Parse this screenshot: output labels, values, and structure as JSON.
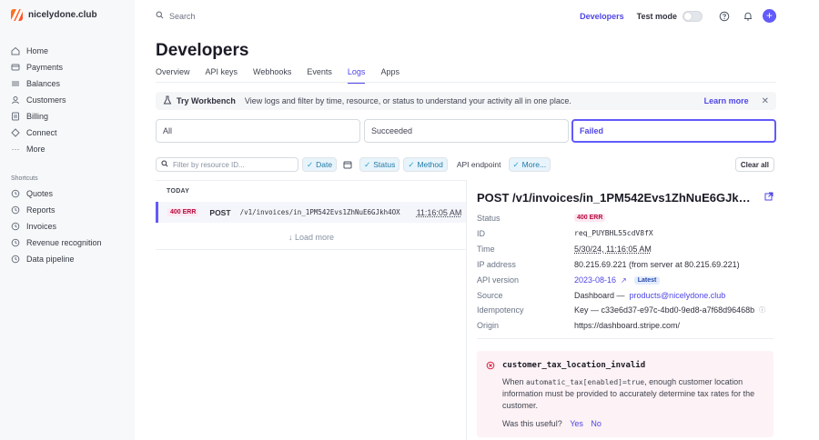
{
  "brand": {
    "name": "nicelydone.club"
  },
  "search": {
    "label": "Search"
  },
  "header": {
    "developers_link": "Developers",
    "test_mode": "Test mode"
  },
  "sidebar": {
    "items": [
      {
        "label": "Home",
        "icon": "home-icon"
      },
      {
        "label": "Payments",
        "icon": "payments-icon"
      },
      {
        "label": "Balances",
        "icon": "balances-icon"
      },
      {
        "label": "Customers",
        "icon": "customers-icon"
      },
      {
        "label": "Billing",
        "icon": "billing-icon"
      },
      {
        "label": "Connect",
        "icon": "connect-icon"
      },
      {
        "label": "More",
        "icon": "more-icon"
      }
    ],
    "shortcuts_title": "Shortcuts",
    "shortcuts": [
      {
        "label": "Quotes"
      },
      {
        "label": "Reports"
      },
      {
        "label": "Invoices"
      },
      {
        "label": "Revenue recognition"
      },
      {
        "label": "Data pipeline"
      }
    ]
  },
  "main": {
    "title": "Developers",
    "tabs": [
      {
        "label": "Overview"
      },
      {
        "label": "API keys"
      },
      {
        "label": "Webhooks"
      },
      {
        "label": "Events"
      },
      {
        "label": "Logs",
        "active": true
      },
      {
        "label": "Apps"
      }
    ],
    "banner": {
      "title": "Try Workbench",
      "description": "View logs and filter by time, resource, or status to understand your activity all in one place.",
      "learn_more": "Learn more"
    },
    "segments": [
      {
        "label": "All"
      },
      {
        "label": "Succeeded"
      },
      {
        "label": "Failed",
        "active": true
      }
    ],
    "filters": {
      "placeholder": "Filter by resource ID...",
      "date": "Date",
      "status": "Status",
      "method": "Method",
      "api_endpoint": "API endpoint",
      "more": "More...",
      "clear_all": "Clear all"
    },
    "log": {
      "group": "TODAY",
      "rows": [
        {
          "status": "400 ERR",
          "method": "POST",
          "path": "/v1/invoices/in_1PM542Evs1ZhNuE6GJkh4OX",
          "time": "11:16:05 AM"
        }
      ],
      "load_more": "Load more"
    }
  },
  "detail": {
    "title": "POST /v1/invoices/in_1PM542Evs1ZhNuE6GJkh4OX...",
    "fields": {
      "status_label": "Status",
      "status_value": "400 ERR",
      "id_label": "ID",
      "id_value": "req_PUYBHL55cdV8fX",
      "time_label": "Time",
      "time_value": "5/30/24, 11:16:05 AM",
      "ip_label": "IP address",
      "ip_value": "80.215.69.221 (from server at 80.215.69.221)",
      "api_label": "API version",
      "api_value": "2023-08-16",
      "api_badge": "Latest",
      "source_label": "Source",
      "source_prefix": "Dashboard —",
      "source_email": "products@nicelydone.club",
      "idem_label": "Idempotency",
      "idem_value": "Key — c33e6d37-e97c-4bd0-9ed8-a7f68d96468b",
      "origin_label": "Origin",
      "origin_value": "https://dashboard.stripe.com/"
    },
    "error": {
      "code": "customer_tax_location_invalid",
      "msg_when": "When",
      "msg_code": "automatic_tax[enabled]=true",
      "msg_rest": ", enough customer location information must be provided to accurately determine tax rates for the customer.",
      "useful": "Was this useful?",
      "yes": "Yes",
      "no": "No"
    }
  },
  "colors": {
    "accent": "#625afa",
    "link": "#4f46e5",
    "error": "#df1b41",
    "sidebar_bg": "#f7f8f9"
  }
}
